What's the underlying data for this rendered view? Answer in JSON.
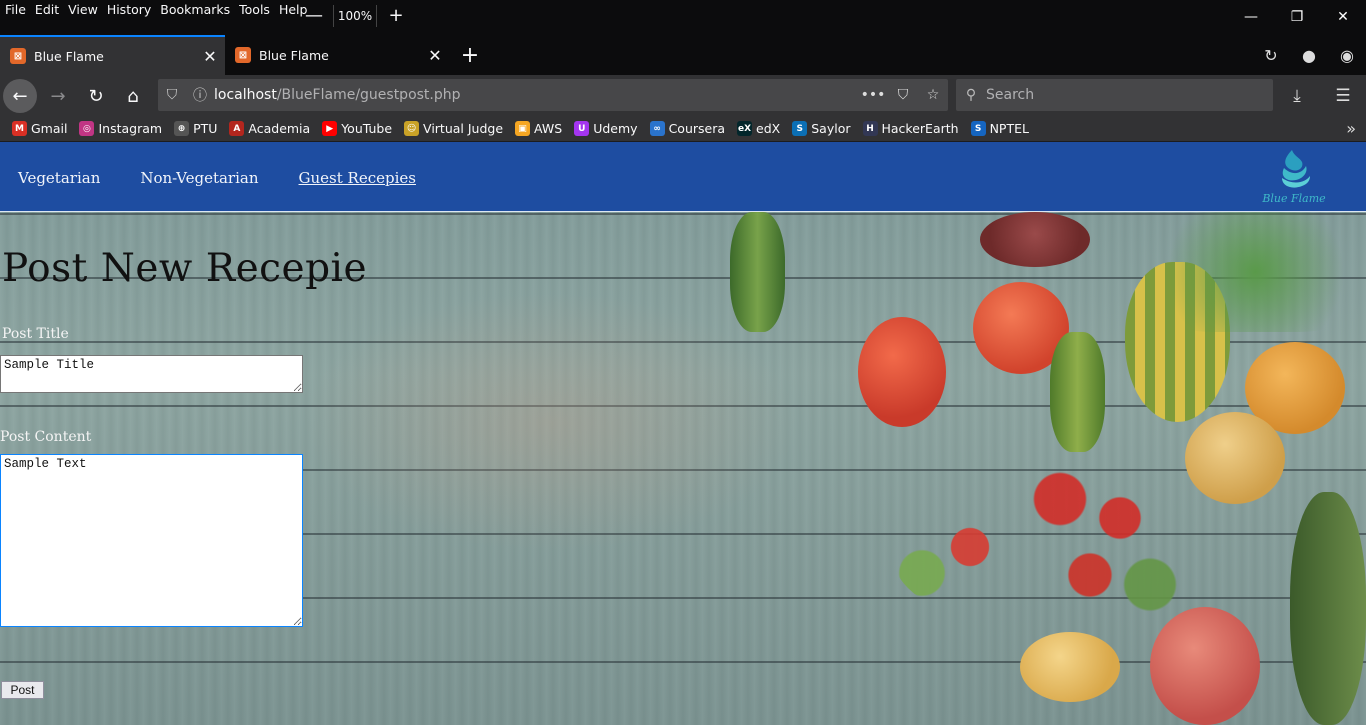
{
  "browser": {
    "menu": [
      "File",
      "Edit",
      "View",
      "History",
      "Bookmarks",
      "Tools",
      "Help"
    ],
    "zoom": {
      "minus": "—",
      "value": "100%",
      "plus": "+"
    },
    "tabs": [
      {
        "title": "Blue Flame",
        "active": true
      },
      {
        "title": "Blue Flame",
        "active": false
      }
    ],
    "url": {
      "host": "localhost",
      "path": "/BlueFlame/guestpost.php"
    },
    "search_placeholder": "Search",
    "bookmarks": [
      {
        "label": "Gmail",
        "color": "#d93025",
        "glyph": "M"
      },
      {
        "label": "Instagram",
        "color": "#c13584",
        "glyph": "◎"
      },
      {
        "label": "PTU",
        "color": "#555555",
        "glyph": "⊕"
      },
      {
        "label": "Academia",
        "color": "#b3261e",
        "glyph": "A"
      },
      {
        "label": "YouTube",
        "color": "#ff0000",
        "glyph": "▶"
      },
      {
        "label": "Virtual Judge",
        "color": "#c9a227",
        "glyph": "☺"
      },
      {
        "label": "AWS",
        "color": "#f5a623",
        "glyph": "▣"
      },
      {
        "label": "Udemy",
        "color": "#a435f0",
        "glyph": "U"
      },
      {
        "label": "Coursera",
        "color": "#2a73cc",
        "glyph": "∞"
      },
      {
        "label": "edX",
        "color": "#02262b",
        "glyph": "eX"
      },
      {
        "label": "Saylor",
        "color": "#0b6fb5",
        "glyph": "S"
      },
      {
        "label": "HackerEarth",
        "color": "#323754",
        "glyph": "H"
      },
      {
        "label": "NPTEL",
        "color": "#1565c0",
        "glyph": "S"
      }
    ]
  },
  "site": {
    "nav": [
      "Vegetarian",
      "Non-Vegetarian",
      "Guest Recepies"
    ],
    "logo_text": "Blue Flame",
    "brand_color": "#1e4da1"
  },
  "form": {
    "heading": "Post New Recepie",
    "title_label": "Post Title",
    "title_value": "Sample Title",
    "content_label": "Post Content",
    "content_value": "Sample Text",
    "submit_label": "Post"
  }
}
